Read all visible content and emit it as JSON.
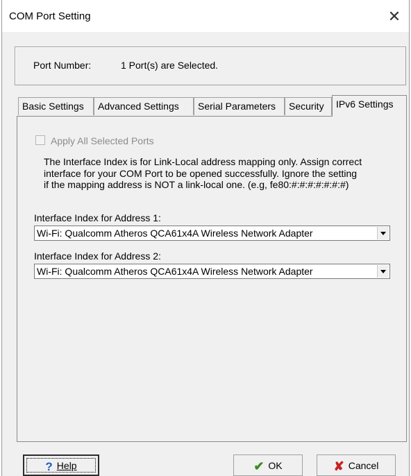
{
  "window": {
    "title": "COM Port Setting",
    "close_glyph": "✕"
  },
  "port": {
    "label": "Port Number:",
    "value": "1 Port(s) are Selected."
  },
  "tabs": [
    {
      "label": "Basic Settings"
    },
    {
      "label": "Advanced Settings"
    },
    {
      "label": "Serial Parameters"
    },
    {
      "label": "Security"
    },
    {
      "label": "IPv6 Settings",
      "active": true
    }
  ],
  "ipv6": {
    "apply_all_label": "Apply All Selected Ports",
    "apply_all_checked": false,
    "apply_all_enabled": false,
    "description_lines": [
      "The Interface Index is for Link-Local address mapping only. Assign correct",
      "interface for your COM Port to be opened successfully. Ignore the setting",
      "if the mapping address is NOT a link-local one. (e.g, fe80:#:#:#:#:#:#:#)"
    ],
    "address1_label": "Interface Index for Address 1:",
    "address1_value": "Wi-Fi: Qualcomm Atheros QCA61x4A Wireless Network Adapter",
    "address2_label": "Interface Index for Address 2:",
    "address2_value": "Wi-Fi: Qualcomm Atheros QCA61x4A Wireless Network Adapter"
  },
  "buttons": {
    "help": {
      "label": "Help",
      "icon": "help-icon",
      "glyph": "?"
    },
    "ok": {
      "label": "OK",
      "icon": "checkmark-icon",
      "glyph": "✔"
    },
    "cancel": {
      "label": "Cancel",
      "icon": "x-icon",
      "glyph": "✘"
    }
  }
}
